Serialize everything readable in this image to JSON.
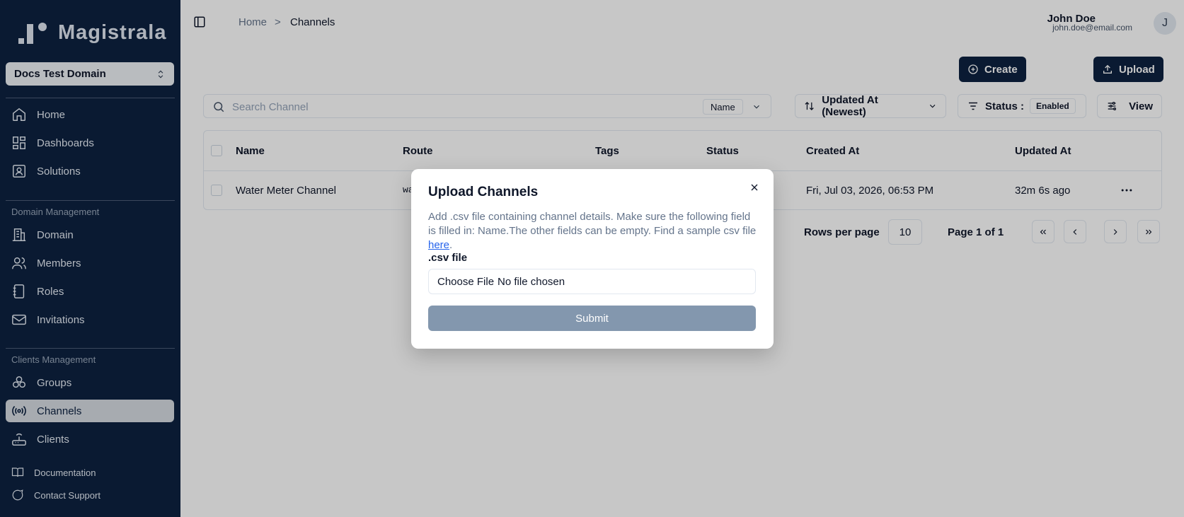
{
  "sidebar": {
    "logo_text": "Magistrala",
    "domain_selector": "Docs Test Domain",
    "nav_main": [
      {
        "label": "Home",
        "icon": "home-icon"
      },
      {
        "label": "Dashboards",
        "icon": "dashboards-icon"
      },
      {
        "label": "Solutions",
        "icon": "solutions-icon"
      }
    ],
    "domain_section_label": "Domain Management",
    "nav_domain": [
      {
        "label": "Domain",
        "icon": "domain-icon"
      },
      {
        "label": "Members",
        "icon": "members-icon"
      },
      {
        "label": "Roles",
        "icon": "roles-icon"
      },
      {
        "label": "Invitations",
        "icon": "invitations-icon"
      }
    ],
    "clients_section_label": "Clients Management",
    "nav_clients": [
      {
        "label": "Groups",
        "icon": "groups-icon"
      },
      {
        "label": "Channels",
        "icon": "channels-icon",
        "active": true
      },
      {
        "label": "Clients",
        "icon": "clients-icon"
      }
    ],
    "footer": [
      {
        "label": "Documentation",
        "icon": "book-icon"
      },
      {
        "label": "Contact Support",
        "icon": "chat-icon"
      }
    ]
  },
  "header": {
    "breadcrumb_home": "Home",
    "breadcrumb_separator": ">",
    "breadcrumb_current": "Channels",
    "user_name": "John Doe",
    "user_email": "john.doe@email.com",
    "avatar_initial": "J"
  },
  "toolbar": {
    "create_label": "Create",
    "upload_label": "Upload",
    "search_placeholder": "Search Channel",
    "search_field": "Name",
    "sort_label": "Updated At (Newest)",
    "status_label": "Status :",
    "status_value": "Enabled",
    "view_label": "View"
  },
  "table": {
    "columns": [
      "Name",
      "Route",
      "Tags",
      "Status",
      "Created At",
      "Updated At"
    ],
    "rows": [
      {
        "name": "Water Meter Channel",
        "route": "wa",
        "created_at": "Fri, Jul 03, 2026, 06:53 PM",
        "updated_at": "32m 6s ago"
      }
    ]
  },
  "pagination": {
    "rows_per_page_label": "Rows per page",
    "rows_per_page": "10",
    "page_label": "Page 1 of 1"
  },
  "modal": {
    "title": "Upload Channels",
    "description": "Add .csv file containing channel details. Make sure the following field is filled in: Name.The other fields can be empty. Find a sample csv file",
    "link_text": "here",
    "link_suffix": ".",
    "file_label": ".csv file",
    "file_button": "Choose File",
    "file_status": "No file chosen",
    "submit_label": "Submit"
  },
  "colors": {
    "sidebar_bg": "#0d2240",
    "primary_button": "#0d2240",
    "submit_disabled": "#8397ae",
    "link": "#2563eb"
  }
}
